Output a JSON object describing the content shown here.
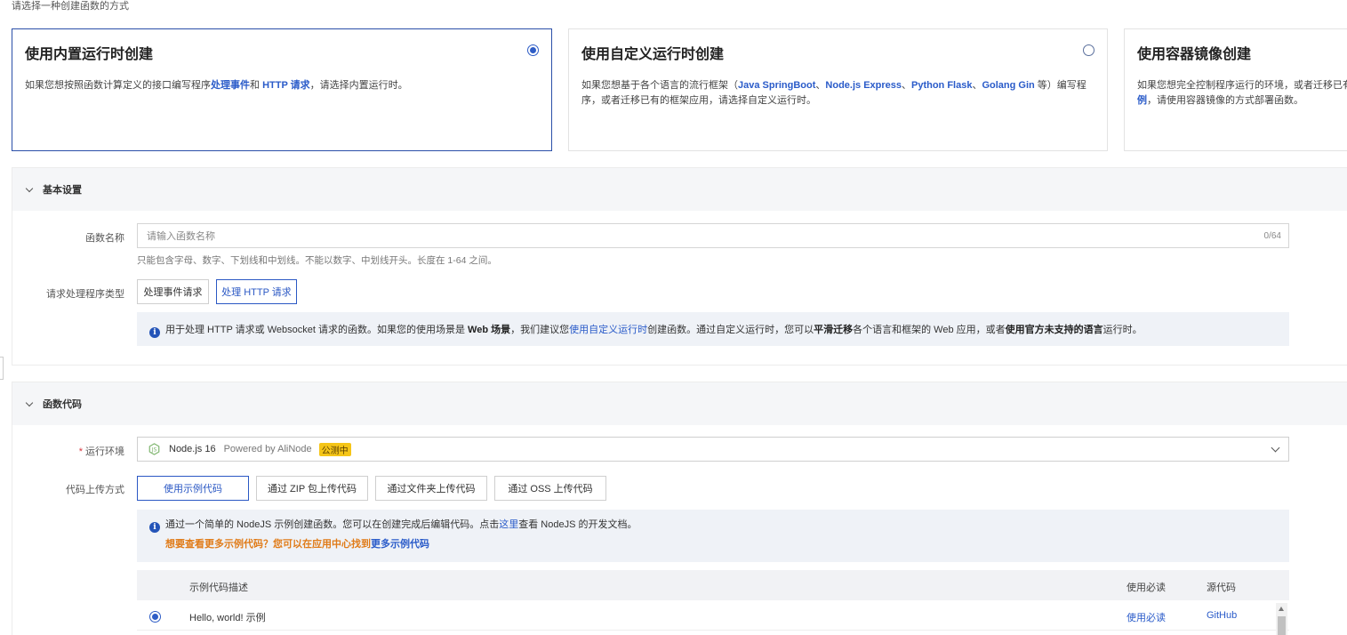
{
  "top_hint": "请选择一种创建函数的方式",
  "cards": [
    {
      "title": "使用内置运行时创建",
      "desc_parts": [
        "如果您想按照函数计算定义的接口编写程序",
        "处理事件",
        "和 ",
        "HTTP 请求",
        "，请选择内置运行时。"
      ],
      "selected": true
    },
    {
      "title": "使用自定义运行时创建",
      "desc_parts": [
        "如果您想基于各个语言的流行框架（",
        "Java SpringBoot",
        "、",
        "Node.js Express",
        "、",
        "Python Flask",
        "、",
        "Golang Gin",
        " 等）编写程序，或者迁移已有的框架应用，请选择自定义运行时。"
      ],
      "selected": false
    },
    {
      "title": "使用容器镜像创建",
      "desc_parts": [
        "如果您想完全控制程序运行的环境，或者迁移已有",
        "例",
        "，请使用容器镜像的方式部署函数。"
      ],
      "selected": false
    }
  ],
  "basic": {
    "title": "基本设置",
    "name_label": "函数名称",
    "name_placeholder": "请输入函数名称",
    "name_count": "0/64",
    "name_help": "只能包含字母、数字、下划线和中划线。不能以数字、中划线开头。长度在 1-64 之间。",
    "handler_label": "请求处理程序类型",
    "handler_options": [
      "处理事件请求",
      "处理 HTTP 请求"
    ],
    "notice_parts": [
      "用于处理 HTTP 请求或 Websocket 请求的函数。如果您的使用场景是 ",
      "Web 场景",
      "，我们建议您",
      "使用自定义运行时",
      "创建函数。通过自定义运行时，您可以",
      "平滑迁移",
      "各个语言和框架的 Web 应用，或者",
      "使用官方未支持的语言",
      "运行时。"
    ]
  },
  "code": {
    "title": "函数代码",
    "runtime_label": "运行环境",
    "runtime_value": "Node.js 16",
    "runtime_powered": "Powered by AliNode",
    "runtime_tag": "公测中",
    "upload_label": "代码上传方式",
    "upload_options": [
      "使用示例代码",
      "通过 ZIP 包上传代码",
      "通过文件夹上传代码",
      "通过 OSS 上传代码"
    ],
    "notice_line1_parts": [
      "通过一个简单的 NodeJS 示例创建函数。您可以在创建完成后编辑代码。点击",
      "这里",
      "查看 NodeJS 的开发文档。"
    ],
    "notice_line2_parts": [
      "想要查看更多示例代码？您可以在应用中心找到",
      "更多示例代码"
    ],
    "table_headers": [
      "示例代码描述",
      "使用必读",
      "源代码"
    ],
    "rows": [
      {
        "desc": "Hello, world! 示例",
        "readme": "使用必读",
        "source": "GitHub"
      }
    ]
  },
  "colors": {
    "accent": "#2b58c4",
    "tag": "#f5c518",
    "warning": "#e07b18"
  }
}
